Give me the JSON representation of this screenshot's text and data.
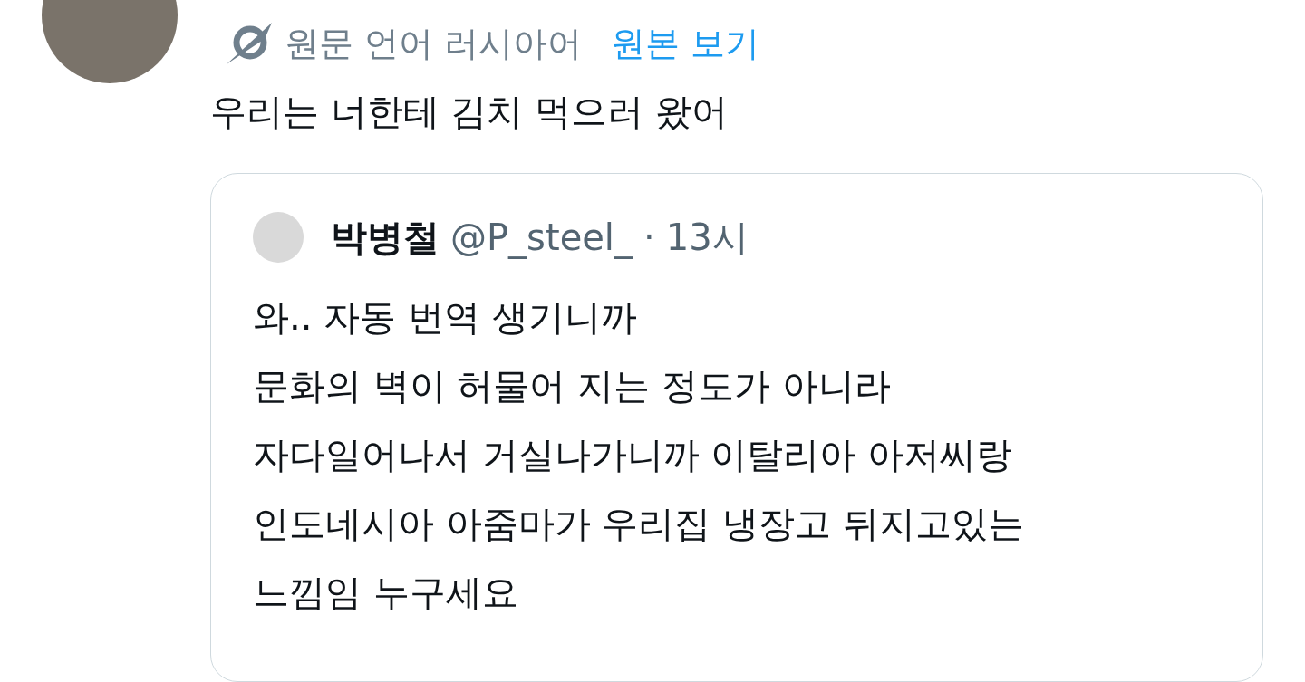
{
  "translation": {
    "note": "원문 언어 러시아어",
    "link": "원본 보기"
  },
  "tweet": {
    "text": "우리는 너한테 김치 먹으러 왔어"
  },
  "quote": {
    "name": "박병철",
    "handle": "@P_steel_",
    "separator": "·",
    "time": "13시",
    "lines": [
      "와.. 자동 번역 생기니까",
      "문화의 벽이 허물어 지는 정도가 아니라",
      "자다일어나서 거실나가니까 이탈리아 아저씨랑",
      "인도네시아 아줌마가 우리집 냉장고 뒤지고있는",
      "느낌임 누구세요"
    ]
  }
}
